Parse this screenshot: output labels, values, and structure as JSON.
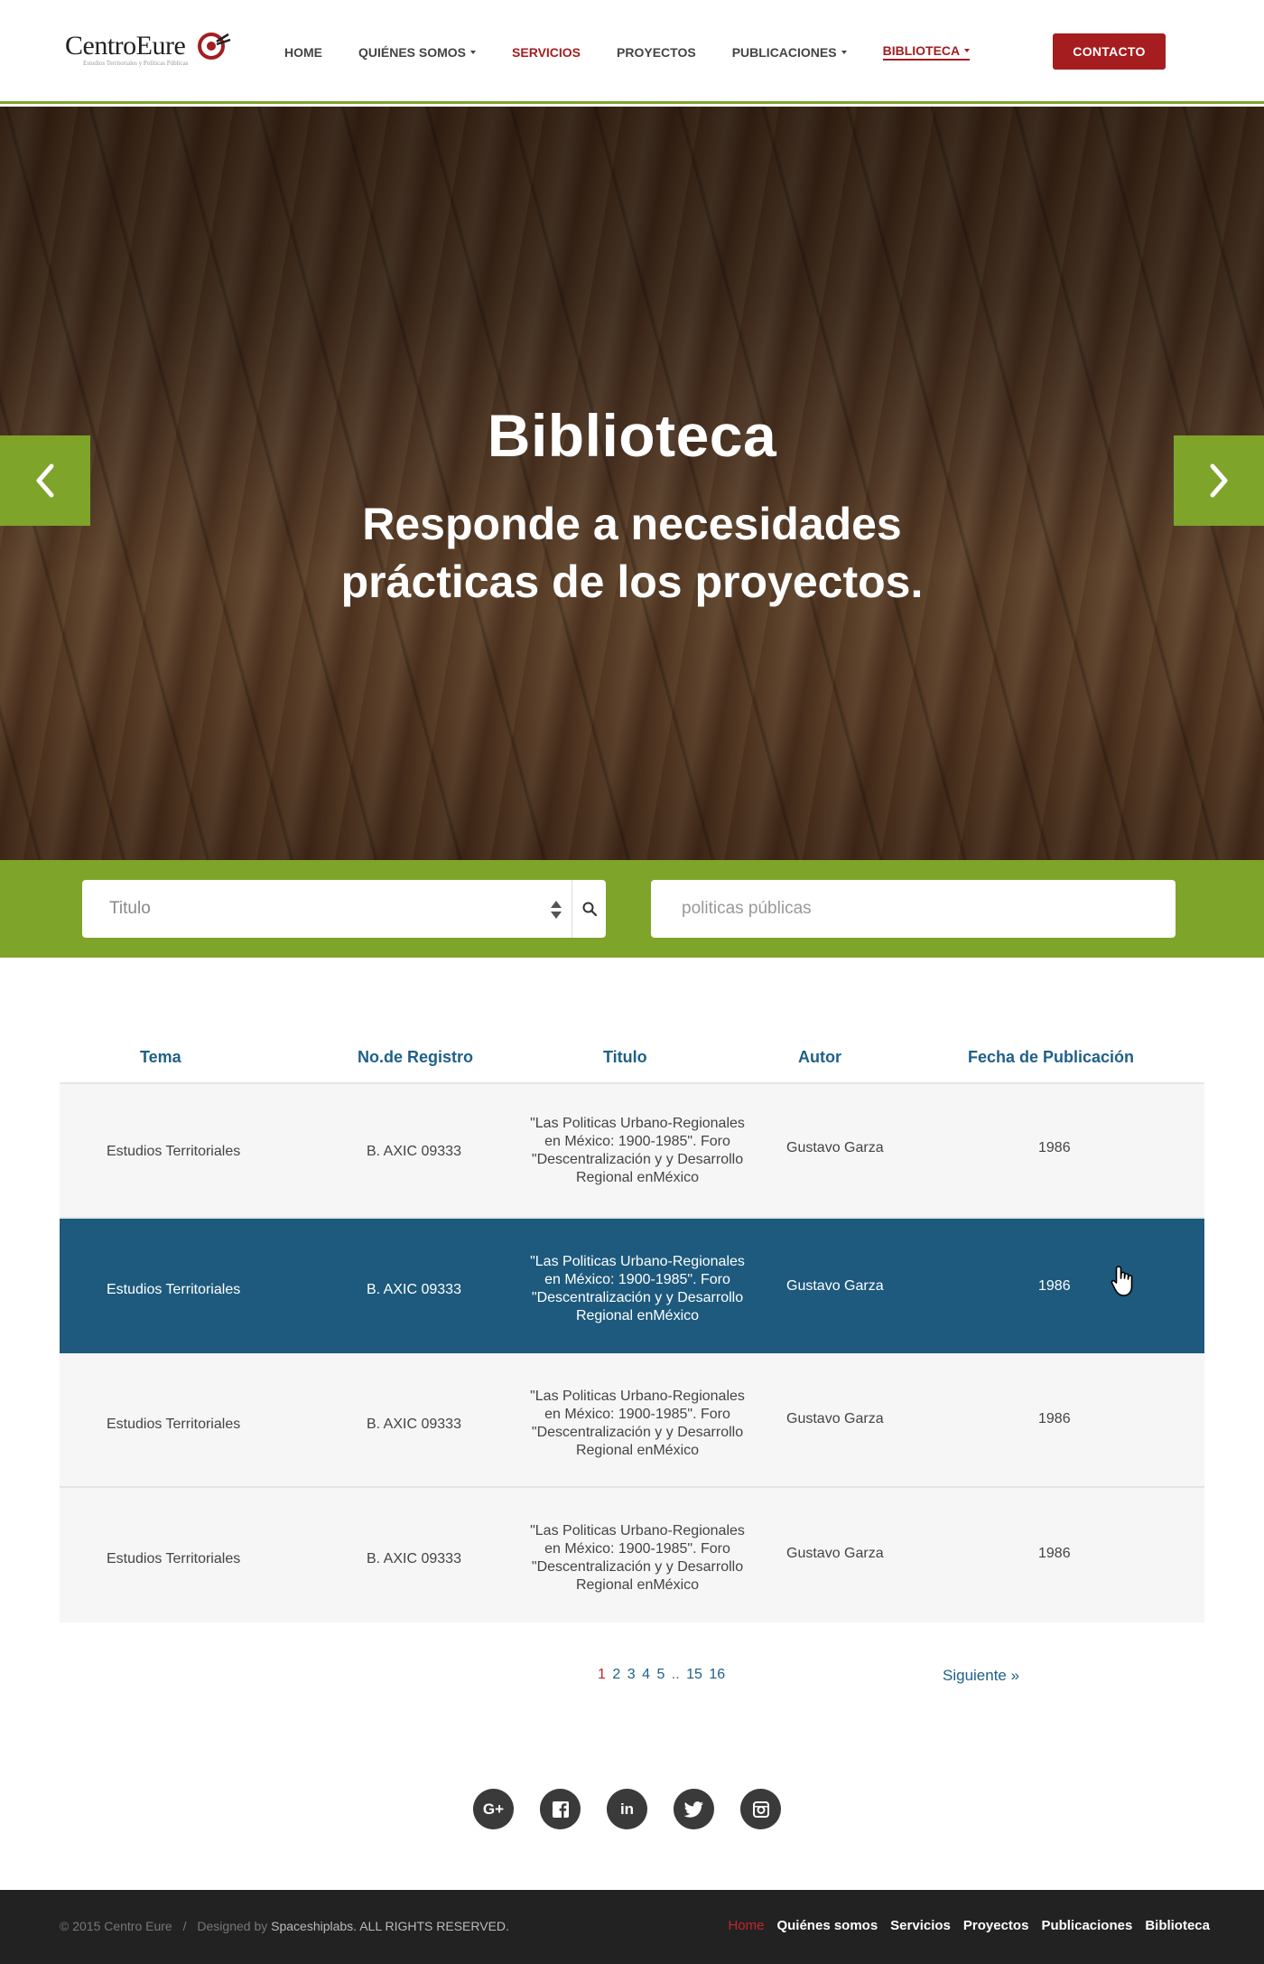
{
  "brand": {
    "name": "CentroEure",
    "tagline": "Estudios Territoriales y Políticas Públicas",
    "accent": "#7ea42a",
    "primary_red": "#a51d1f",
    "link_blue": "#1f6089"
  },
  "nav": {
    "items": [
      {
        "label": "HOME"
      },
      {
        "label": "QUIÉNES SOMOS"
      },
      {
        "label": "SERVICIOS"
      },
      {
        "label": "PROYECTOS"
      },
      {
        "label": "PUBLICACIONES"
      },
      {
        "label": "BIBLIOTECA"
      }
    ],
    "contact": "CONTACTO"
  },
  "hero": {
    "title": "Biblioteca",
    "subtitle_line1": "Responde a necesidades",
    "subtitle_line2": "prácticas de los proyectos.",
    "prev_icon": "chevron-left-icon",
    "next_icon": "chevron-right-icon"
  },
  "search": {
    "select_value": "Titulo",
    "input_placeholder": "politicas públicas",
    "search_icon": "search-icon"
  },
  "table": {
    "headers": [
      "Tema",
      "No.de Registro",
      "Titulo",
      "Autor",
      "Fecha de Publicación"
    ],
    "rows": [
      {
        "tema": "Estudios Territoriales",
        "registro": "B. AXIC 09333",
        "titulo": "\"Las Politicas Urbano-Regionales en México: 1900-1985\". Foro \"Descentralización y y Desarrollo Regional enMéxico",
        "autor": "Gustavo Garza",
        "fecha": "1986"
      },
      {
        "tema": "Estudios Territoriales",
        "registro": "B. AXIC 09333",
        "titulo": "\"Las Politicas Urbano-Regionales en México: 1900-1985\". Foro \"Descentralización y y Desarrollo Regional enMéxico",
        "autor": "Gustavo Garza",
        "fecha": "1986"
      },
      {
        "tema": "Estudios Territoriales",
        "registro": "B. AXIC 09333",
        "titulo": "\"Las Politicas Urbano-Regionales en México: 1900-1985\". Foro \"Descentralización y y Desarrollo Regional enMéxico",
        "autor": "Gustavo Garza",
        "fecha": "1986"
      },
      {
        "tema": "Estudios Territoriales",
        "registro": "B. AXIC 09333",
        "titulo": "\"Las Politicas Urbano-Regionales en México: 1900-1985\". Foro \"Descentralización y y Desarrollo Regional enMéxico",
        "autor": "Gustavo Garza",
        "fecha": "1986"
      }
    ]
  },
  "pagination": {
    "pages": [
      "1",
      "2",
      "3",
      "4",
      "5",
      "..",
      "15",
      "16"
    ],
    "current": "1",
    "next": "Siguiente »"
  },
  "social": [
    {
      "icon": "google-plus-icon",
      "glyph": "G+"
    },
    {
      "icon": "facebook-icon",
      "glyph": "f"
    },
    {
      "icon": "linkedin-icon",
      "glyph": "in"
    },
    {
      "icon": "twitter-icon",
      "glyph": "t"
    },
    {
      "icon": "instagram-icon",
      "glyph": "◎"
    }
  ],
  "footer": {
    "copyright": "© 2015 Centro Eure",
    "separator": "/",
    "designed_by": "Designed by",
    "designer": "Spaceshiplabs. ALL RIGHTS RESERVED.",
    "links": [
      "Home",
      "Quiénes somos",
      "Servicios",
      "Proyectos",
      "Publicaciones",
      "Biblioteca"
    ]
  }
}
